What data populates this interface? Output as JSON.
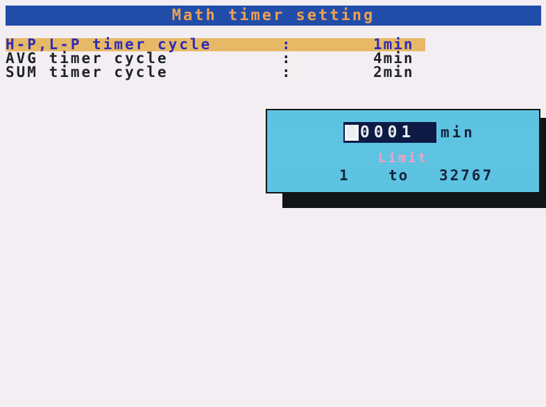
{
  "title": "Math timer setting",
  "settings": [
    {
      "label": "H-P,L-P timer cycle",
      "separator": ":",
      "value": "1min"
    },
    {
      "label": "AVG timer cycle",
      "separator": ":",
      "value": "4min"
    },
    {
      "label": "SUM timer cycle",
      "separator": ":",
      "value": "2min"
    }
  ],
  "dialog": {
    "input_value": "00001",
    "unit": "min",
    "limit_label": "Limit",
    "limit_min": "1",
    "limit_to": "to",
    "limit_max": "32767"
  },
  "colors": {
    "title_bar": "#1d4aa8",
    "title_text": "#f0a050",
    "selected_row": "#e7b966",
    "dialog_bg": "#5fc5e4",
    "limit_text": "#f1a2c6"
  }
}
